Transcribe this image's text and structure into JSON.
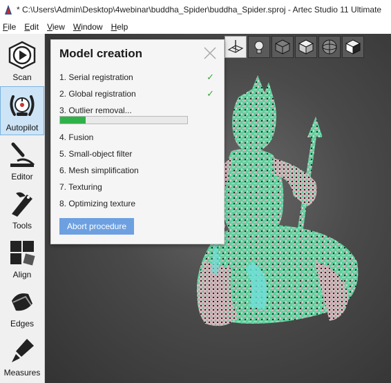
{
  "window": {
    "title": "* C:\\Users\\Admin\\Desktop\\4webinar\\buddha_Spider\\buddha_Spider.sproj - Artec Studio 11 Ultimate"
  },
  "menu": [
    {
      "label": "File",
      "key": "F",
      "rest": "ile"
    },
    {
      "label": "Edit",
      "key": "E",
      "rest": "dit"
    },
    {
      "label": "View",
      "key": "V",
      "rest": "iew"
    },
    {
      "label": "Window",
      "key": "W",
      "rest": "indow"
    },
    {
      "label": "Help",
      "key": "H",
      "rest": "elp"
    }
  ],
  "sidebar": {
    "items": [
      {
        "label": "Scan",
        "icon": "scan-icon"
      },
      {
        "label": "Autopilot",
        "icon": "autopilot-icon",
        "active": true
      },
      {
        "label": "Editor",
        "icon": "editor-icon"
      },
      {
        "label": "Tools",
        "icon": "tools-icon"
      },
      {
        "label": "Align",
        "icon": "align-icon"
      },
      {
        "label": "Edges",
        "icon": "edges-icon"
      },
      {
        "label": "Measures",
        "icon": "measures-icon"
      }
    ]
  },
  "view_toolbar": [
    "grid-icon",
    "lightbulb-icon",
    "cube-wireframe-icon",
    "cube-solid-icon",
    "sphere-icon",
    "cube-textured-icon"
  ],
  "panel": {
    "title": "Model creation",
    "steps": [
      {
        "label": "1. Serial registration",
        "done": "✓"
      },
      {
        "label": "2. Global registration",
        "done": "✓"
      },
      {
        "label": "3. Outlier removal...",
        "progress": 0.2
      },
      {
        "label": "4. Fusion"
      },
      {
        "label": "5. Small-object filter"
      },
      {
        "label": "6. Mesh simplification"
      },
      {
        "label": "7. Texturing"
      },
      {
        "label": "8. Optimizing texture"
      }
    ],
    "abort_label": "Abort procedure"
  },
  "colors": {
    "accent": "#6da0e0",
    "progress": "#2fb14a",
    "check": "#3aa33a",
    "viewport_bg": "#4a4a4a"
  }
}
